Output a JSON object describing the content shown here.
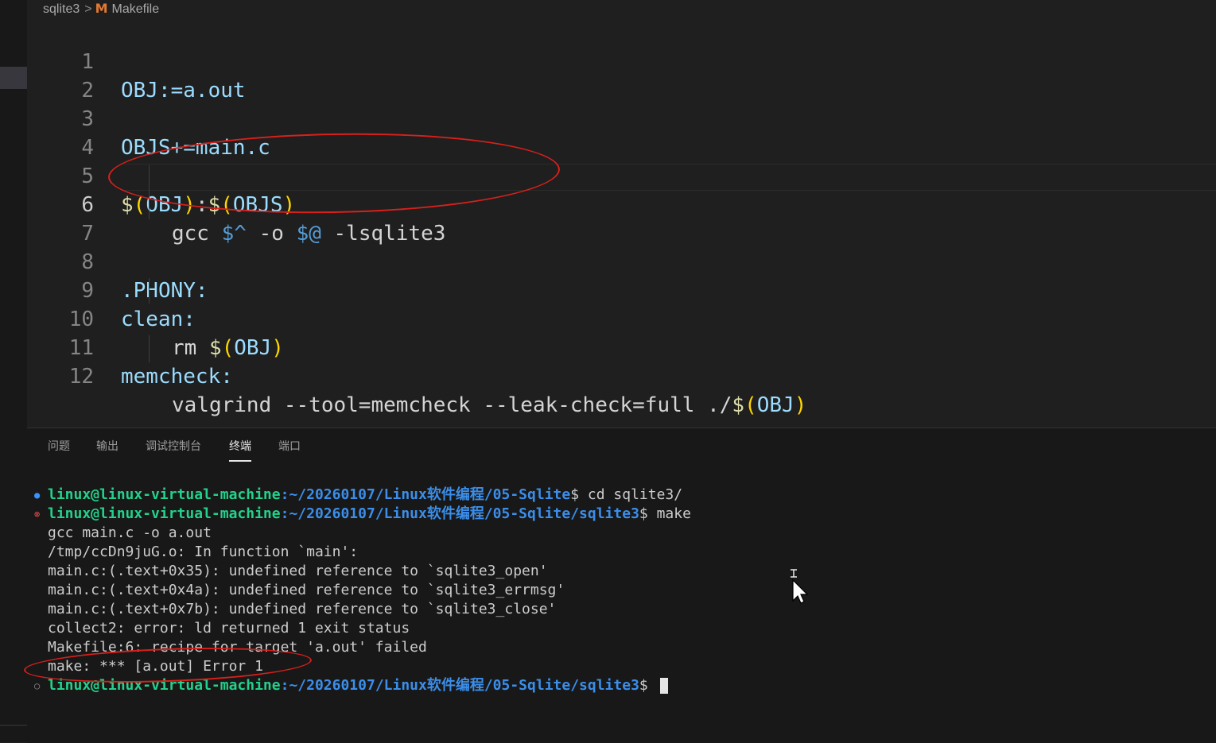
{
  "breadcrumb": {
    "folder": "sqlite3",
    "separator": ">",
    "file_icon_letter": "M",
    "file": "Makefile"
  },
  "editor": {
    "line_numbers": [
      "1",
      "2",
      "3",
      "4",
      "5",
      "6",
      "7",
      "8",
      "9",
      "10",
      "11",
      "12"
    ],
    "active_line": "6",
    "lines": {
      "l1": "OBJ:=a.out",
      "l3": "OBJS+=main.c",
      "l5": {
        "d1": "$",
        "p1": "(",
        "v1": "OBJ",
        "p2": ")",
        "colon": ":",
        "d2": "$",
        "p3": "(",
        "v2": "OBJS",
        "p4": ")"
      },
      "l6": {
        "cmd": "gcc ",
        "a1": "$^",
        "o": " -o ",
        "a2": "$@",
        "rest": " -lsqlite3"
      },
      "l8": ".PHONY:",
      "l9": "clean:",
      "l10": {
        "cmd": "rm ",
        "d": "$",
        "p1": "(",
        "v": "OBJ",
        "p2": ")"
      },
      "l11": "memcheck:",
      "l12": {
        "cmd": "valgrind --tool=memcheck --leak-check=full ./",
        "d": "$",
        "p1": "(",
        "v": "OBJ",
        "p2": ")"
      }
    }
  },
  "panel": {
    "tabs": [
      "问题",
      "输出",
      "调试控制台",
      "终端",
      "端口"
    ],
    "active_tab": "终端"
  },
  "terminal": {
    "lines": [
      {
        "marker": "●",
        "user": "linux@linux-virtual-machine",
        "path": ":~/20260107/Linux软件编程/05-Sqlite",
        "cmd": "$ cd sqlite3/"
      },
      {
        "marker": "⊗",
        "user": "linux@linux-virtual-machine",
        "path": ":~/20260107/Linux软件编程/05-Sqlite/sqlite3",
        "cmd": "$ make"
      },
      {
        "text": "gcc main.c -o a.out"
      },
      {
        "text": "/tmp/ccDn9juG.o: In function `main':"
      },
      {
        "text": "main.c:(.text+0x35): undefined reference to `sqlite3_open'"
      },
      {
        "text": "main.c:(.text+0x4a): undefined reference to `sqlite3_errmsg'"
      },
      {
        "text": "main.c:(.text+0x7b): undefined reference to `sqlite3_close'"
      },
      {
        "text": "collect2: error: ld returned 1 exit status"
      },
      {
        "text": "Makefile:6: recipe for target 'a.out' failed"
      },
      {
        "text": "make: *** [a.out] Error 1"
      },
      {
        "marker": "○",
        "user": "linux@linux-virtual-machine",
        "path": ":~/20260107/Linux软件编程/05-Sqlite/sqlite3",
        "cmd": "$ "
      }
    ]
  },
  "colors": {
    "annotation_red": "#d8201b",
    "prompt_green": "#23d18b",
    "prompt_blue": "#3b8eea"
  }
}
